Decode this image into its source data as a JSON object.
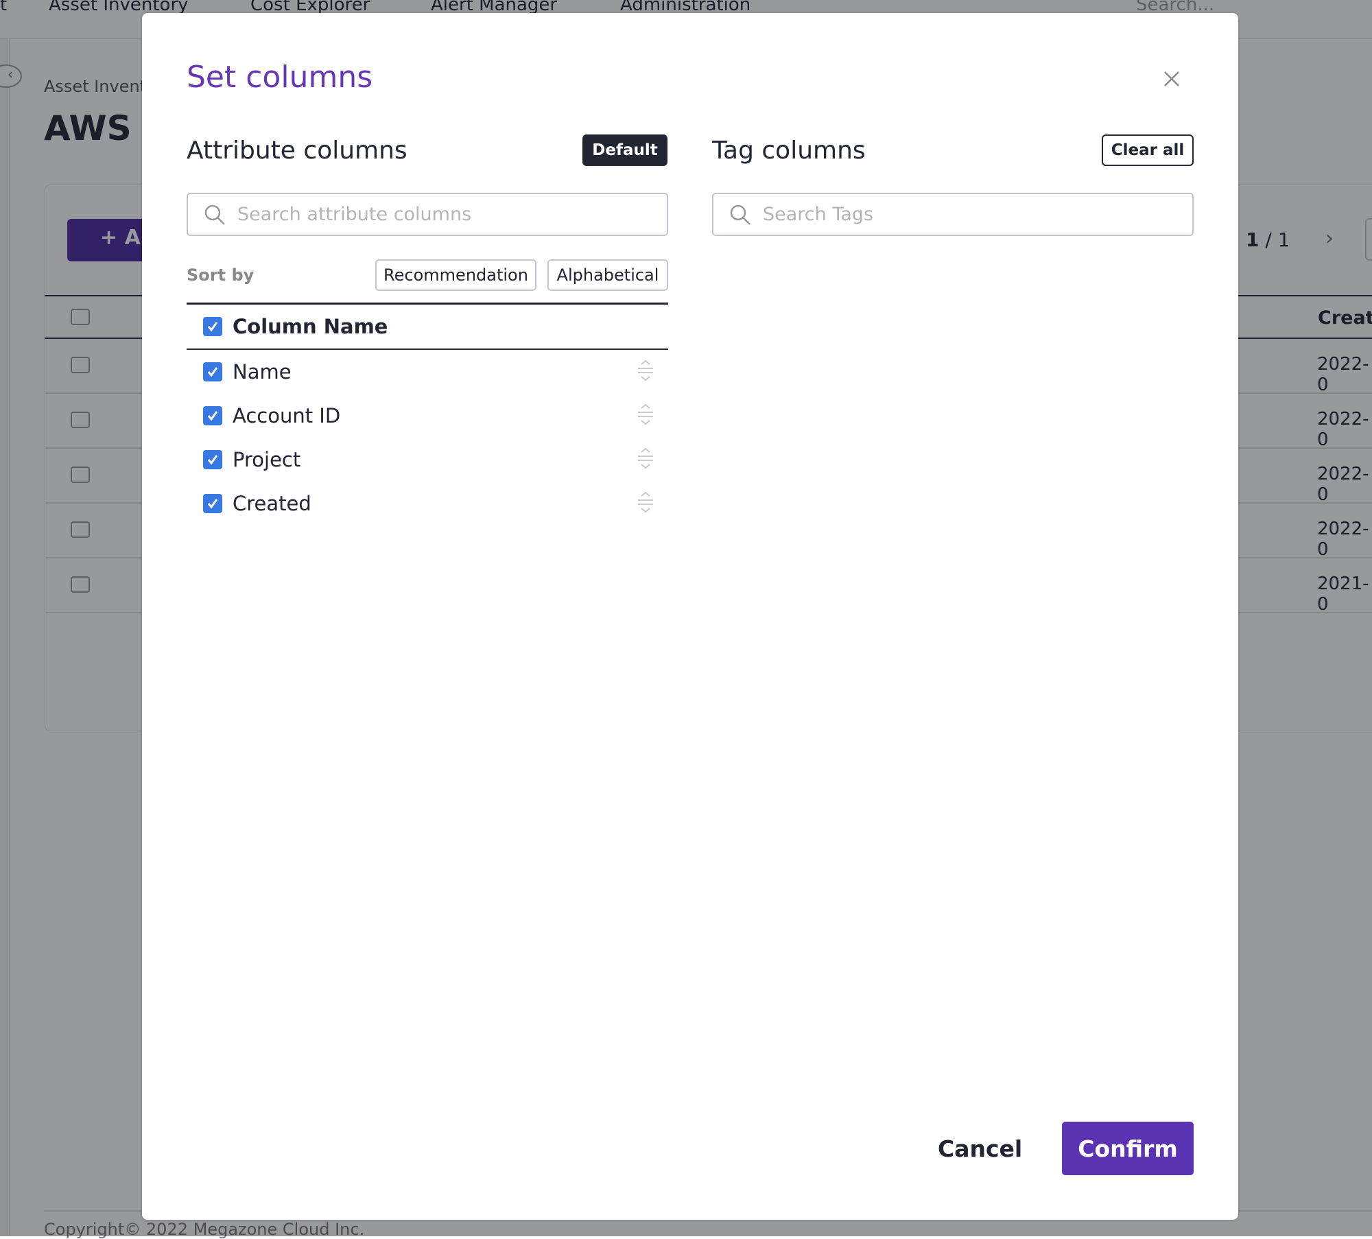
{
  "nav": {
    "items": [
      "t",
      "Asset Inventory",
      "Cost Explorer",
      "Alert Manager",
      "Administration"
    ],
    "search_placeholder": "Search..."
  },
  "page": {
    "breadcrumb": "Asset Invent",
    "title": "AWS A",
    "add_button": "+ A",
    "pagination": {
      "current": "1",
      "separator": "/",
      "total": "1"
    },
    "column_header": "Creat",
    "dates": [
      "2022-0",
      "2022-0",
      "2022-0",
      "2022-0",
      "2021-0"
    ],
    "footer": "Copyright© 2022 Megazone Cloud Inc."
  },
  "modal": {
    "title": "Set columns",
    "attribute": {
      "heading": "Attribute columns",
      "default_button": "Default",
      "search_placeholder": "Search attribute columns",
      "sort_label": "Sort by",
      "sort_options": [
        "Recommendation",
        "Alphabetical"
      ],
      "header": {
        "label": "Column Name",
        "checked": true
      },
      "items": [
        {
          "label": "Name",
          "checked": true
        },
        {
          "label": "Account ID",
          "checked": true
        },
        {
          "label": "Project",
          "checked": true
        },
        {
          "label": "Created",
          "checked": true
        }
      ]
    },
    "tag": {
      "heading": "Tag columns",
      "clear_button": "Clear all",
      "search_placeholder": "Search Tags"
    },
    "cancel": "Cancel",
    "confirm": "Confirm"
  },
  "colors": {
    "accent": "#6638b6",
    "confirm": "#5b34b4",
    "checkbox": "#3878e1",
    "dark": "#222532"
  }
}
